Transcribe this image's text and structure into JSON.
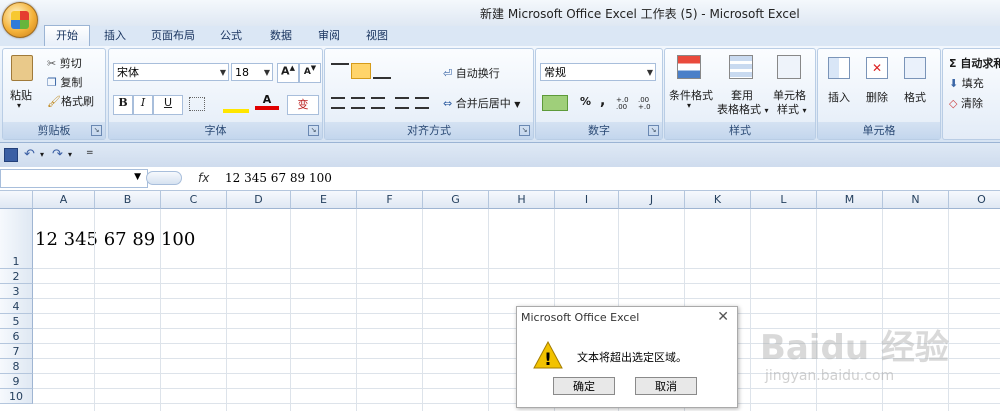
{
  "window": {
    "title": "新建 Microsoft Office Excel 工作表 (5) - Microsoft Excel"
  },
  "tabs": [
    "开始",
    "插入",
    "页面布局",
    "公式",
    "数据",
    "审阅",
    "视图"
  ],
  "ribbon": {
    "clipboard": {
      "label": "剪贴板",
      "paste": "粘贴",
      "cut": "剪切",
      "copy": "复制",
      "format_painter": "格式刷"
    },
    "font": {
      "label": "字体",
      "font_name": "宋体",
      "font_size": "18",
      "bold": "B",
      "italic": "I",
      "underline": "U",
      "grow": "A",
      "shrink": "A",
      "font_color": "A",
      "phonetic": "变"
    },
    "alignment": {
      "label": "对齐方式",
      "wrap_text": "自动换行",
      "merge_center": "合并后居中"
    },
    "number": {
      "label": "数字",
      "format": "常规",
      "percent": "%",
      "comma": ",",
      "inc_decimal": "+.0 .00",
      "dec_decimal": ".00 +.0"
    },
    "styles": {
      "label": "样式",
      "conditional": "条件格式",
      "table_format_1": "套用",
      "table_format_2": "表格格式",
      "cell_styles_1": "单元格",
      "cell_styles_2": "样式"
    },
    "cells": {
      "label": "单元格",
      "insert": "插入",
      "delete": "删除",
      "format": "格式"
    },
    "editing": {
      "autosum": "Σ 自动求和",
      "fill": "填充",
      "clear": "清除"
    }
  },
  "formula_bar": {
    "fx": "fx",
    "value": "12 345 67 89 100"
  },
  "columns": [
    "A",
    "B",
    "C",
    "D",
    "E",
    "F",
    "G",
    "H",
    "I",
    "J",
    "K",
    "L",
    "M",
    "N",
    "O"
  ],
  "rows": [
    "1",
    "2",
    "3",
    "4",
    "5",
    "6",
    "7",
    "8",
    "9",
    "10"
  ],
  "cell_a1": "12 345 67 89 100",
  "dialog": {
    "title": "Microsoft Office Excel",
    "message": "文本将超出选定区域。",
    "ok": "确定",
    "cancel": "取消",
    "close": "✕",
    "warning_glyph": "!"
  },
  "watermark": {
    "brand": "Baidu 经验",
    "url": "jingyan.baidu.com"
  },
  "colors": {
    "ribbon": "#dbe7f5",
    "accent": "#2b4a75",
    "warning": "#f2c200"
  }
}
